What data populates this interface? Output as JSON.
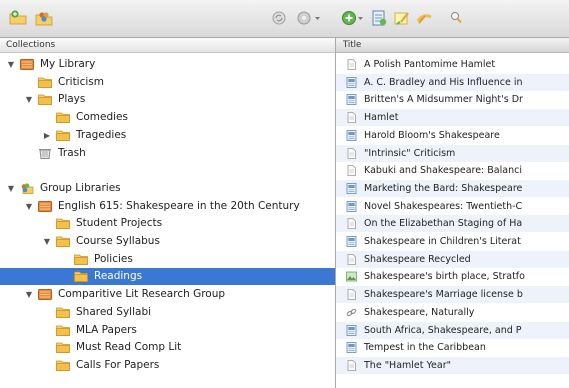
{
  "toolbar": {
    "left_icons": [
      "new-collection-icon",
      "new-group-icon",
      "sync-icon",
      "actions-gear-icon"
    ],
    "right_icons": [
      "new-item-icon",
      "add-by-identifier-icon",
      "new-note-icon",
      "attach-icon",
      "search-icon"
    ]
  },
  "collections": {
    "header": "Collections",
    "tree": [
      {
        "label": "My Library",
        "level": 0,
        "expanded": true,
        "icon": "library-icon"
      },
      {
        "label": "Criticism",
        "level": 1,
        "icon": "folder-icon"
      },
      {
        "label": "Plays",
        "level": 1,
        "expanded": true,
        "icon": "folder-icon"
      },
      {
        "label": "Comedies",
        "level": 2,
        "icon": "folder-icon"
      },
      {
        "label": "Tragedies",
        "level": 2,
        "expanded": false,
        "icon": "folder-icon"
      },
      {
        "label": "Trash",
        "level": 1,
        "icon": "trash-icon"
      },
      {
        "label": "",
        "level": 0,
        "spacer": true
      },
      {
        "label": "Group Libraries",
        "level": 0,
        "expanded": true,
        "icon": "group-icon"
      },
      {
        "label": "English 615: Shakespeare in the 20th Century",
        "level": 1,
        "expanded": true,
        "icon": "library-icon"
      },
      {
        "label": "Student Projects",
        "level": 2,
        "icon": "folder-icon"
      },
      {
        "label": "Course Syllabus",
        "level": 2,
        "expanded": true,
        "icon": "folder-icon"
      },
      {
        "label": "Policies",
        "level": 3,
        "icon": "folder-icon"
      },
      {
        "label": "Readings",
        "level": 3,
        "icon": "folder-icon",
        "selected": true
      },
      {
        "label": "Comparitive Lit Research Group",
        "level": 1,
        "expanded": true,
        "icon": "library-icon"
      },
      {
        "label": "Shared Syllabi",
        "level": 2,
        "icon": "folder-icon"
      },
      {
        "label": "MLA Papers",
        "level": 2,
        "icon": "folder-icon"
      },
      {
        "label": "Must Read Comp Lit",
        "level": 2,
        "icon": "folder-icon"
      },
      {
        "label": "Calls For Papers",
        "level": 2,
        "icon": "folder-icon"
      }
    ]
  },
  "items": {
    "header": "Title",
    "rows": [
      {
        "title": "A Polish Pantomime Hamlet",
        "icon": "document-icon"
      },
      {
        "title": "A. C. Bradley and His Influence in",
        "icon": "journal-article-icon"
      },
      {
        "title": "Britten's A Midsummer Night's Dr",
        "icon": "journal-article-icon"
      },
      {
        "title": "Hamlet",
        "icon": "document-icon"
      },
      {
        "title": "Harold Bloom's Shakespeare",
        "icon": "journal-article-icon"
      },
      {
        "title": "\"Intrinsic\" Criticism",
        "icon": "document-icon"
      },
      {
        "title": "Kabuki and Shakespeare: Balanci",
        "icon": "document-icon"
      },
      {
        "title": "Marketing the Bard: Shakespeare",
        "icon": "journal-article-icon"
      },
      {
        "title": "Novel Shakespeares: Twentieth-C",
        "icon": "journal-article-icon"
      },
      {
        "title": "On the Elizabethan Staging of Ha",
        "icon": "document-icon"
      },
      {
        "title": "Shakespeare in Children's Literat",
        "icon": "journal-article-icon"
      },
      {
        "title": "Shakespeare Recycled",
        "icon": "document-icon"
      },
      {
        "title": "Shakespeare's birth place, Stratfo",
        "icon": "image-icon"
      },
      {
        "title": "Shakespeare's Marriage license b",
        "icon": "document-icon"
      },
      {
        "title": "Shakespeare, Naturally",
        "icon": "link-icon"
      },
      {
        "title": "South Africa, Shakespeare, and P",
        "icon": "journal-article-icon"
      },
      {
        "title": "Tempest in the Caribbean",
        "icon": "journal-article-icon"
      },
      {
        "title": "The \"Hamlet Year\"",
        "icon": "document-icon"
      }
    ]
  }
}
